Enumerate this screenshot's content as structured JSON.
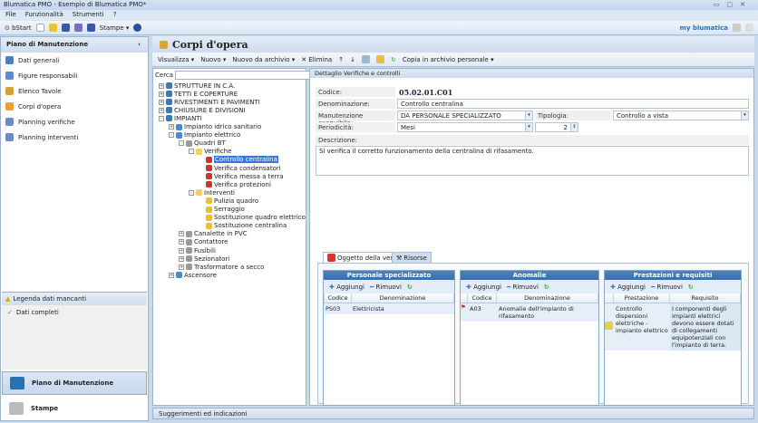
{
  "window": {
    "title": "Blumatica PMO - Esempio di Blumatica PMO*"
  },
  "menu": [
    "File",
    "Funzionalità",
    "Strumenti",
    "?"
  ],
  "toolbar": {
    "bstart": "bStart",
    "stampe": "Stampe ▾",
    "brand": "my blumatica"
  },
  "left": {
    "title": "Piano di Manutenzione",
    "items": [
      "Dati generali",
      "Figure responsabili",
      "Elenco Tavole",
      "Corpi d'opera",
      "Planning verifiche",
      "Planning interventi"
    ],
    "legend_title": "Legenda dati mancanti",
    "legend_items": [
      "Dati completi"
    ],
    "nav": [
      "Piano di Manutenzione",
      "Stampe"
    ]
  },
  "main": {
    "title": "Corpi d'opera",
    "toolbar": [
      "Visualizza ▾",
      "Nuovo ▾",
      "Nuovo da archivio ▾",
      "Elimina",
      "Copia in archivio personale ▾"
    ]
  },
  "tree": {
    "search_label": "Cerca",
    "search_value": "",
    "nodes": [
      {
        "l": 0,
        "t": "STRUTTURE IN C.A.",
        "pm": "+",
        "c": "#3a78b8"
      },
      {
        "l": 0,
        "t": "TETTI E COPERTURE",
        "pm": "+",
        "c": "#3a78b8"
      },
      {
        "l": 0,
        "t": "RIVESTIMENTI E PAVIMENTI",
        "pm": "+",
        "c": "#3a78b8"
      },
      {
        "l": 0,
        "t": "CHIUSURE E DIVISIONI",
        "pm": "+",
        "c": "#3a78b8"
      },
      {
        "l": 0,
        "t": "IMPIANTI",
        "pm": "-",
        "c": "#3a78b8"
      },
      {
        "l": 1,
        "t": "Impianto idrico sanitario",
        "pm": "+",
        "c": "#4a8ac8"
      },
      {
        "l": 1,
        "t": "Impianto elettrico",
        "pm": "-",
        "c": "#4a8ac8"
      },
      {
        "l": 2,
        "t": "Quadri BT",
        "pm": "-",
        "c": "#999"
      },
      {
        "l": 3,
        "t": "Verifiche",
        "pm": "-",
        "c": "#f0d060"
      },
      {
        "l": 4,
        "t": "Controllo centralina",
        "pm": "",
        "c": "#c33",
        "sel": true
      },
      {
        "l": 4,
        "t": "Verifica condensatori",
        "pm": "",
        "c": "#c33"
      },
      {
        "l": 4,
        "t": "Verifica messa a terra",
        "pm": "",
        "c": "#c33"
      },
      {
        "l": 4,
        "t": "Verifica protezioni",
        "pm": "",
        "c": "#c33"
      },
      {
        "l": 3,
        "t": "Interventi",
        "pm": "-",
        "c": "#f0d060"
      },
      {
        "l": 4,
        "t": "Pulizia quadro",
        "pm": "",
        "c": "#e8c030"
      },
      {
        "l": 4,
        "t": "Serraggio",
        "pm": "",
        "c": "#e8c030"
      },
      {
        "l": 4,
        "t": "Sostituzione quadro elettrico",
        "pm": "",
        "c": "#e8c030"
      },
      {
        "l": 4,
        "t": "Sostituzione centralina",
        "pm": "",
        "c": "#e8c030"
      },
      {
        "l": 2,
        "t": "Canalette in PVC",
        "pm": "+",
        "c": "#999"
      },
      {
        "l": 2,
        "t": "Contattore",
        "pm": "+",
        "c": "#999"
      },
      {
        "l": 2,
        "t": "Fusibili",
        "pm": "+",
        "c": "#999"
      },
      {
        "l": 2,
        "t": "Sezionatori",
        "pm": "+",
        "c": "#999"
      },
      {
        "l": 2,
        "t": "Trasformatore a secco",
        "pm": "+",
        "c": "#999"
      },
      {
        "l": 1,
        "t": "Ascensore",
        "pm": "+",
        "c": "#4a8ac8"
      }
    ]
  },
  "detail": {
    "title": "Dettaglio Verifiche e controlli",
    "codice_label": "Codice:",
    "codice": "05.02.01.C01",
    "denominazione_label": "Denominazione:",
    "denominazione": "Controllo centralina",
    "manutenzione_label": "Manutenzione eseguibile:",
    "manutenzione": "DA PERSONALE SPECIALIZZATO",
    "tipologia_label": "Tipologia:",
    "tipologia": "Controllo a vista",
    "periodicita_label": "Periodicità:",
    "periodicita": "Mesi",
    "periodo": "2",
    "descrizione_label": "Descrizione:",
    "descrizione": "Si verifica il corretto funzionamento della centralina di rifasamento.",
    "tabs": [
      "Oggetto della verifica",
      "Risorse"
    ],
    "add": "Aggiungi",
    "remove": "Rimuovi",
    "grids": [
      {
        "title": "Personale specializzato",
        "cols": [
          "Codice",
          "Denominazione"
        ],
        "rows": [
          [
            "PS03",
            "Elettricista"
          ]
        ]
      },
      {
        "title": "Anomalie",
        "cols": [
          "Codice",
          "Denominazione"
        ],
        "rows": [
          [
            "A03",
            "Anomalie dell'impianto di rifasamento"
          ]
        ]
      },
      {
        "title": "Prestazioni e requisiti",
        "cols": [
          "Prestazione",
          "Requisito"
        ],
        "rows": [
          [
            "Controllo dispersioni elettriche - impianto elettrico",
            "I componenti degli impianti elettrici devono essere dotati di collegamenti equipotenziali con l'impianto di terra."
          ]
        ]
      }
    ]
  },
  "status": "Suggerimenti ed indicazioni"
}
